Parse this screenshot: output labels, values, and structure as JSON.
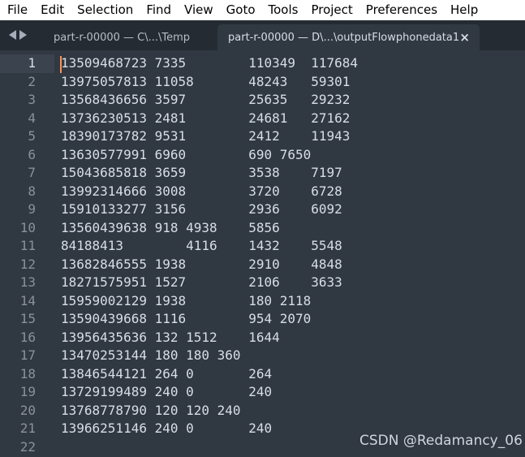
{
  "menu": [
    "File",
    "Edit",
    "Selection",
    "Find",
    "View",
    "Goto",
    "Tools",
    "Project",
    "Preferences",
    "Help"
  ],
  "tabs": {
    "inactive_label": "part-r-00000 — C\\...\\Temp",
    "active_label": "part-r-00000 — D\\...\\outputFlowphonedata1",
    "close_glyph": "×"
  },
  "icons": {
    "nav_left": "triangle-left",
    "nav_right": "triangle-right",
    "close": "close-x"
  },
  "colors": {
    "background": "#303841",
    "tab_bar": "#242b32",
    "text": "#d8dee9",
    "line_numbers": "#8a9198",
    "caret": "#f99157"
  },
  "lines": [
    "13509468723 7335\t110349\t117684",
    "13975057813 11058\t48243\t59301",
    "13568436656 3597\t25635\t29232",
    "13736230513 2481\t24681\t27162",
    "18390173782 9531\t2412\t11943",
    "13630577991 6960\t690 7650",
    "15043685818 3659\t3538\t7197",
    "13992314666 3008\t3720\t6728",
    "15910133277 3156\t2936\t6092",
    "13560439638 918 4938\t5856",
    "84188413\t4116\t1432\t5548",
    "13682846555 1938\t2910\t4848",
    "18271575951 1527\t2106\t3633",
    "15959002129 1938\t180 2118",
    "13590439668 1116\t954 2070",
    "13956435636 132 1512\t1644",
    "13470253144 180 180 360",
    "13846544121 264 0\t264",
    "13729199489 240 0\t240",
    "13768778790 120 120 240",
    "13966251146 240 0\t240",
    ""
  ],
  "line_numbers": [
    "1",
    "2",
    "3",
    "4",
    "5",
    "6",
    "7",
    "8",
    "9",
    "10",
    "11",
    "12",
    "13",
    "14",
    "15",
    "16",
    "17",
    "18",
    "19",
    "20",
    "21",
    "22"
  ],
  "watermark": "CSDN @Redamancy_06"
}
